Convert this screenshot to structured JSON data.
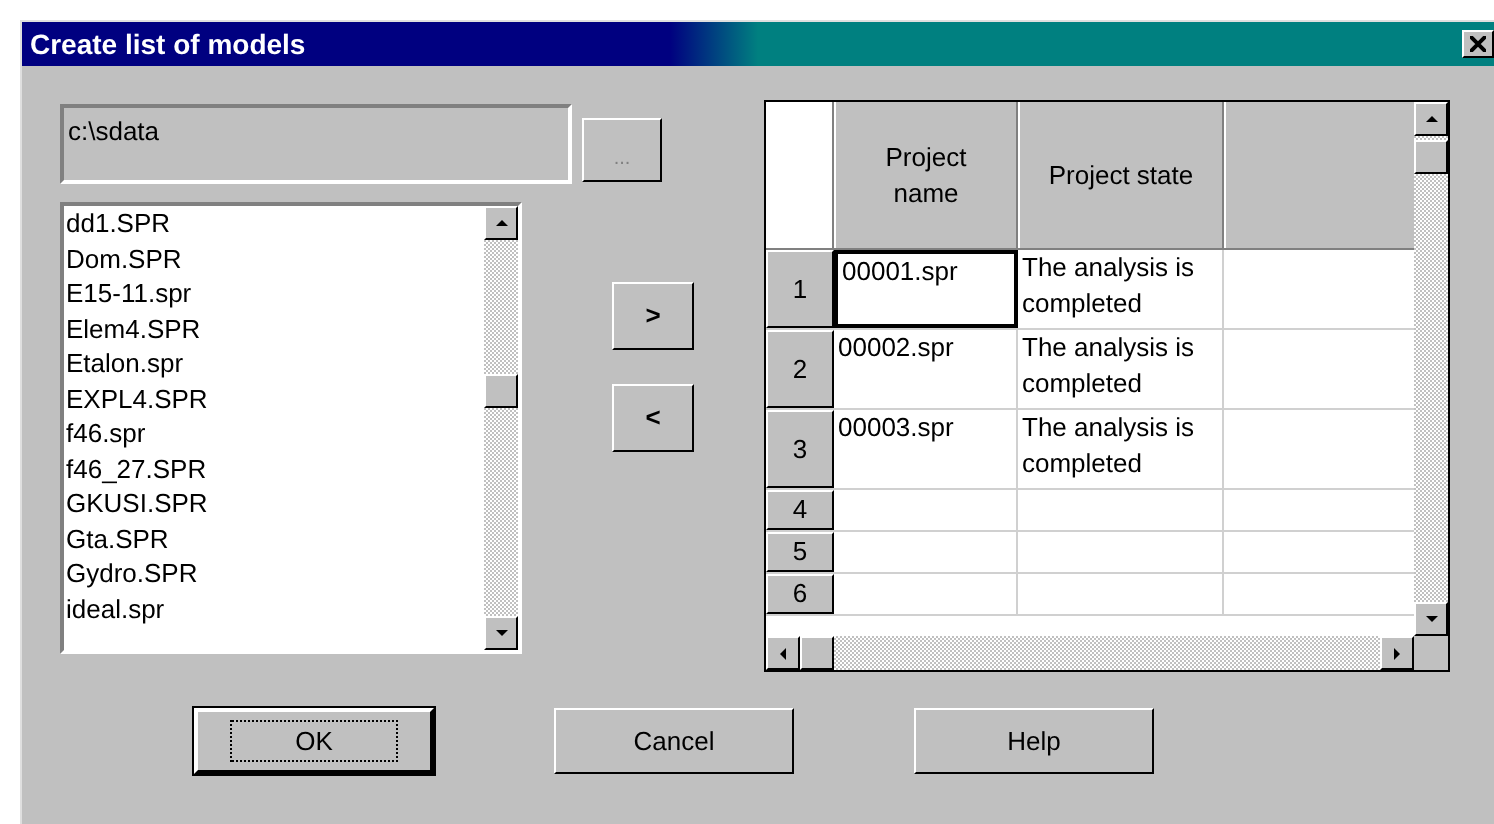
{
  "window": {
    "title": "Create list of models"
  },
  "path_field": {
    "value": "c:\\sdata"
  },
  "browse_button": {
    "label": "..."
  },
  "file_list": [
    "dd1.SPR",
    "Dom.SPR",
    "E15-11.spr",
    "Elem4.SPR",
    "Etalon.spr",
    "EXPL4.SPR",
    "f46.spr",
    "f46_27.SPR",
    "GKUSI.SPR",
    "Gta.SPR",
    "Gydro.SPR",
    "ideal.spr"
  ],
  "move_buttons": [
    {
      "label": ">"
    },
    {
      "label": "<"
    }
  ],
  "table": {
    "columns": [
      "Project name",
      "Project state"
    ],
    "rows": [
      {
        "number": "1",
        "cells": [
          {
            "text": "00001.spr",
            "selected": true
          },
          {
            "text": "The analysis is completed",
            "selected": false
          }
        ]
      },
      {
        "number": "2",
        "cells": [
          {
            "text": "00002.spr",
            "selected": false
          },
          {
            "text": "The analysis is completed",
            "selected": false
          }
        ]
      },
      {
        "number": "3",
        "cells": [
          {
            "text": "00003.spr",
            "selected": false
          },
          {
            "text": "The analysis is completed",
            "selected": false
          }
        ]
      },
      {
        "number": "4",
        "cells": []
      },
      {
        "number": "5",
        "cells": []
      },
      {
        "number": "6",
        "cells": []
      }
    ]
  },
  "buttons": [
    {
      "label": "OK",
      "default": true
    },
    {
      "label": "Cancel",
      "default": false
    },
    {
      "label": "Help",
      "default": false
    }
  ]
}
